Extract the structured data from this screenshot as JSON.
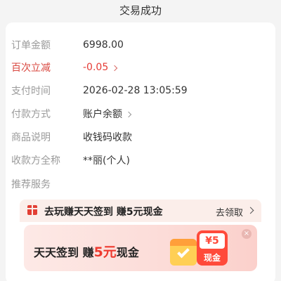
{
  "header": {
    "title": "交易成功"
  },
  "details": [
    {
      "label": "订单金额",
      "value": "6998.00"
    },
    {
      "label": "百次立减",
      "value": "-0.05"
    },
    {
      "label": "支付时间",
      "value": "2026-02-28 13:05:59"
    },
    {
      "label": "付款方式",
      "value": "账户余额"
    },
    {
      "label": "商品说明",
      "value": "收钱码收款"
    },
    {
      "label": "收款方全称",
      "value": "**丽(个人)"
    },
    {
      "label": "推荐服务",
      "value": ""
    }
  ],
  "promo": {
    "text": "去玩赚天天签到 赚5元现金",
    "link": "去领取"
  },
  "banner": {
    "text_a": "天天签到 赚",
    "text_em": "5元",
    "text_b": "现金",
    "close": "×",
    "coupon_amount": "¥5",
    "coupon_label": "现金"
  },
  "colors": {
    "accent_red": "#e53b35",
    "label_gray": "#9a9a9a",
    "promo_bg": "#fbeeea"
  }
}
